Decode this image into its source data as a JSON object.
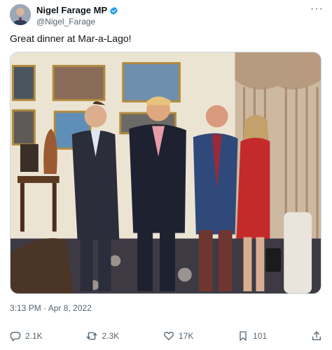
{
  "author": {
    "display_name": "Nigel Farage MP",
    "handle": "@Nigel_Farage",
    "verified": true,
    "verified_color": "#1d9bf0"
  },
  "more_label": "···",
  "tweet": {
    "text": "Great dinner at Mar-a-Lago!",
    "timestamp": "3:13 PM · Apr 8, 2022"
  },
  "actions": {
    "replies": "2.1K",
    "retweets": "2.3K",
    "likes": "17K",
    "bookmarks": "101"
  },
  "icons": [
    "verified-badge-icon",
    "more-icon",
    "reply-icon",
    "retweet-icon",
    "like-icon",
    "bookmark-icon",
    "share-icon"
  ],
  "colors": {
    "text": "#0f1419",
    "secondary": "#536471",
    "border": "#cfd9de"
  }
}
